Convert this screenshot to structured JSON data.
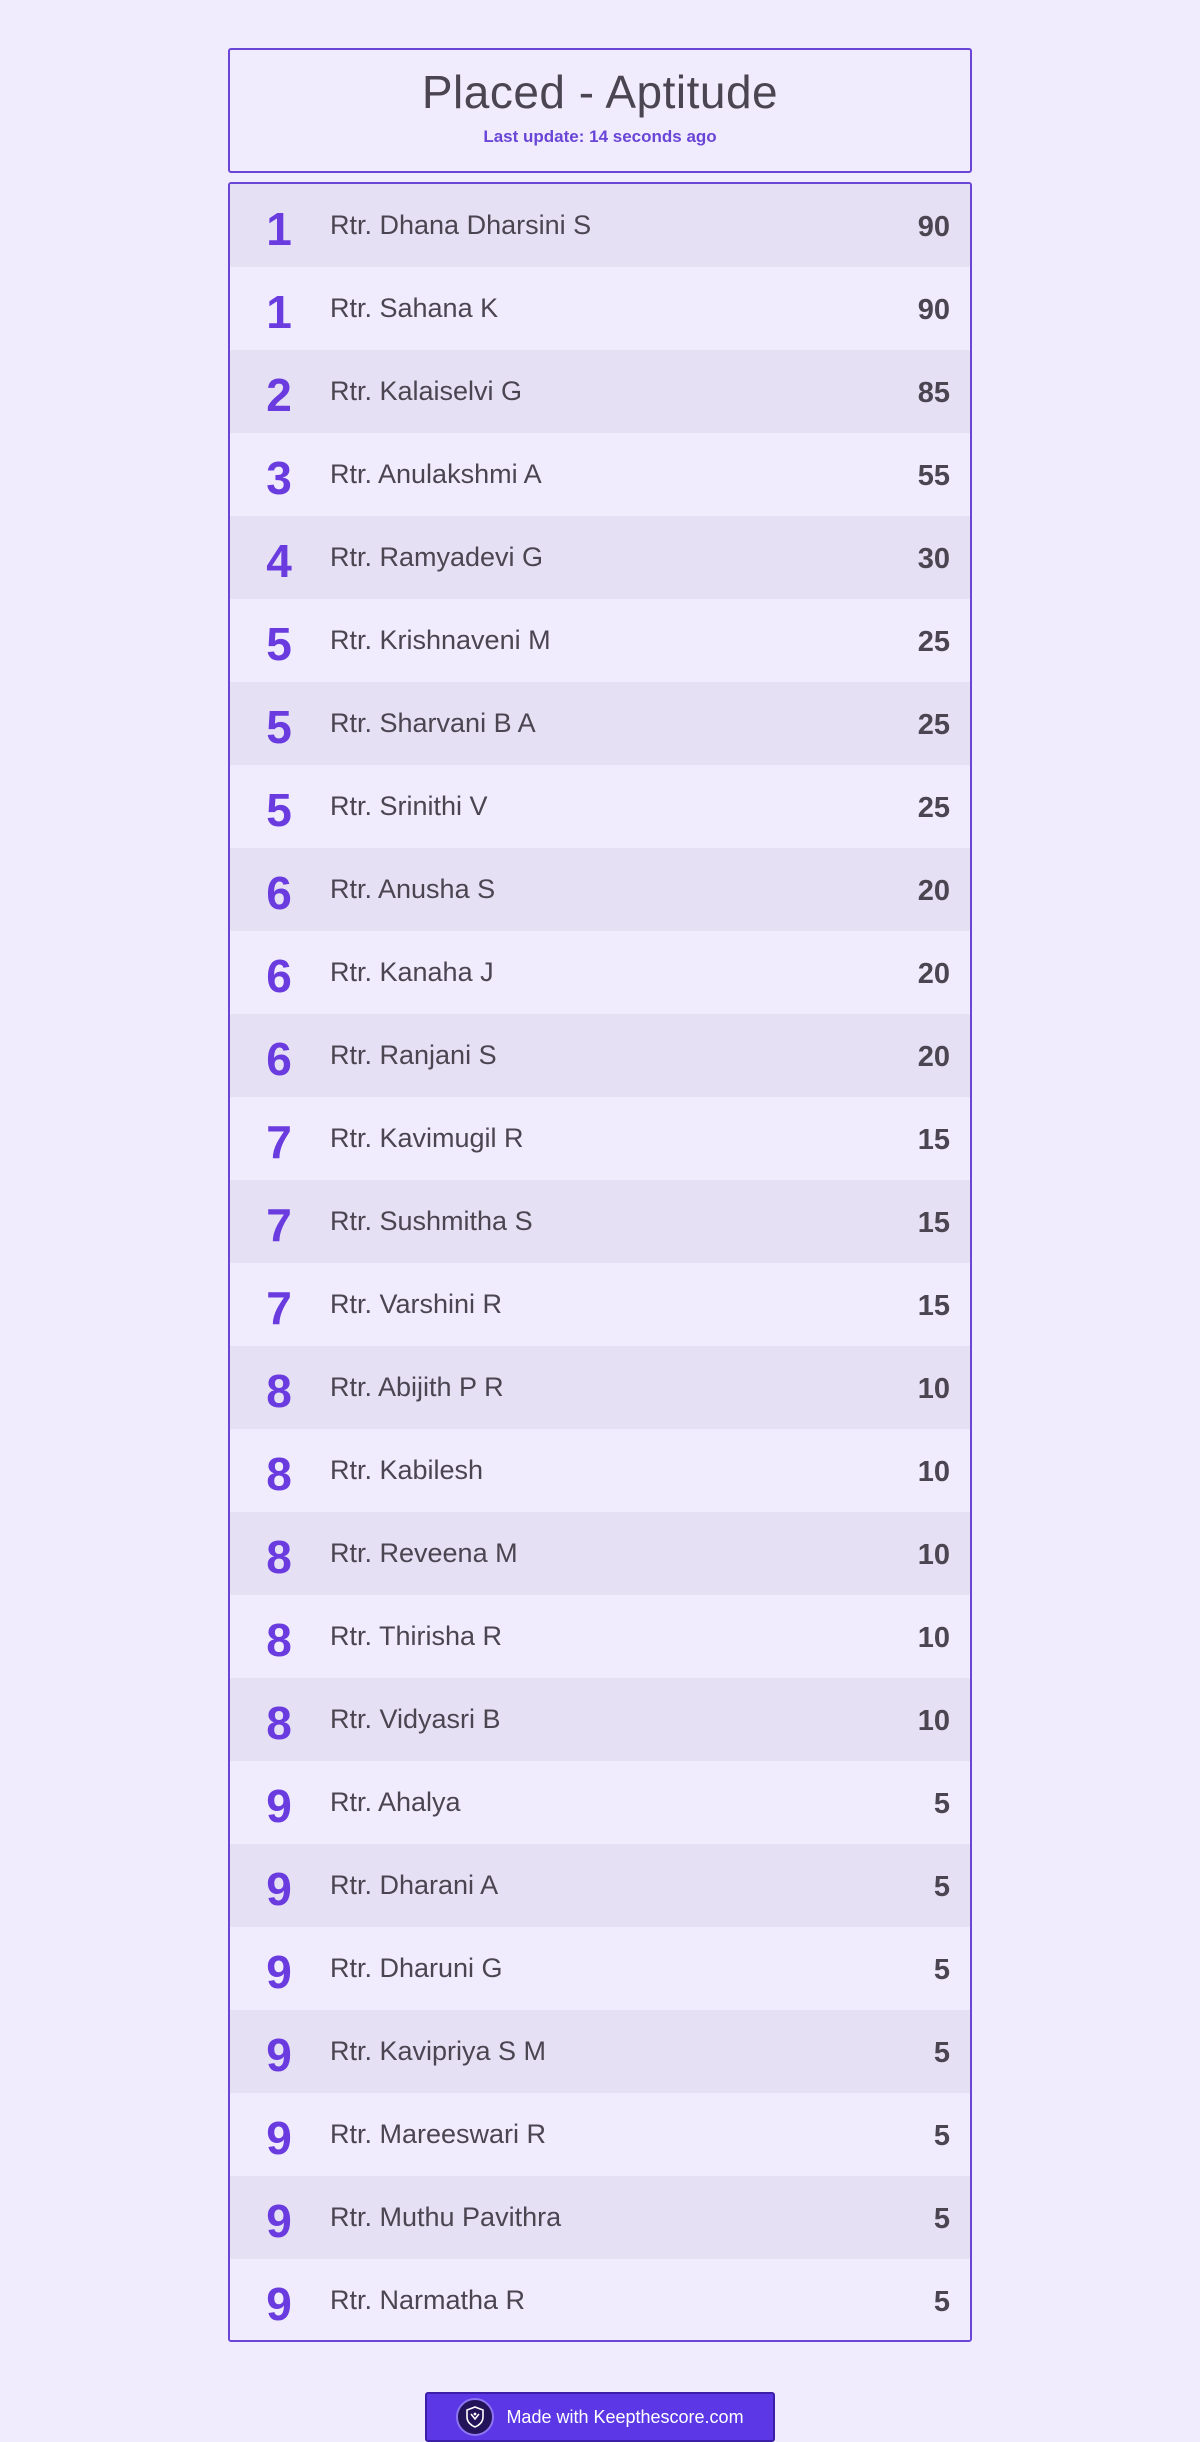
{
  "header": {
    "title": "Placed - Aptitude",
    "last_update": "Last update: 14 seconds ago"
  },
  "leaderboard": {
    "rows": [
      {
        "rank": "1",
        "name": "Rtr. Dhana Dharsini S",
        "score": "90"
      },
      {
        "rank": "1",
        "name": "Rtr. Sahana K",
        "score": "90"
      },
      {
        "rank": "2",
        "name": "Rtr. Kalaiselvi G",
        "score": "85"
      },
      {
        "rank": "3",
        "name": "Rtr. Anulakshmi A",
        "score": "55"
      },
      {
        "rank": "4",
        "name": "Rtr. Ramyadevi G",
        "score": "30"
      },
      {
        "rank": "5",
        "name": "Rtr. Krishnaveni M",
        "score": "25"
      },
      {
        "rank": "5",
        "name": "Rtr. Sharvani B A",
        "score": "25"
      },
      {
        "rank": "5",
        "name": "Rtr. Srinithi V",
        "score": "25"
      },
      {
        "rank": "6",
        "name": "Rtr. Anusha S",
        "score": "20"
      },
      {
        "rank": "6",
        "name": "Rtr. Kanaha J",
        "score": "20"
      },
      {
        "rank": "6",
        "name": "Rtr. Ranjani S",
        "score": "20"
      },
      {
        "rank": "7",
        "name": "Rtr. Kavimugil R",
        "score": "15"
      },
      {
        "rank": "7",
        "name": "Rtr. Sushmitha S",
        "score": "15"
      },
      {
        "rank": "7",
        "name": "Rtr. Varshini R",
        "score": "15"
      },
      {
        "rank": "8",
        "name": "Rtr. Abijith P R",
        "score": "10"
      },
      {
        "rank": "8",
        "name": "Rtr. Kabilesh",
        "score": "10"
      },
      {
        "rank": "8",
        "name": "Rtr. Reveena M",
        "score": "10"
      },
      {
        "rank": "8",
        "name": "Rtr. Thirisha R",
        "score": "10"
      },
      {
        "rank": "8",
        "name": "Rtr. Vidyasri B",
        "score": "10"
      },
      {
        "rank": "9",
        "name": "Rtr. Ahalya",
        "score": "5"
      },
      {
        "rank": "9",
        "name": "Rtr. Dharani A",
        "score": "5"
      },
      {
        "rank": "9",
        "name": "Rtr. Dharuni G",
        "score": "5"
      },
      {
        "rank": "9",
        "name": "Rtr. Kavipriya S M",
        "score": "5"
      },
      {
        "rank": "9",
        "name": "Rtr. Mareeswari R",
        "score": "5"
      },
      {
        "rank": "9",
        "name": "Rtr. Muthu Pavithra",
        "score": "5"
      },
      {
        "rank": "9",
        "name": "Rtr. Narmatha R",
        "score": "5"
      }
    ]
  },
  "footer": {
    "badge_text": "Made with Keepthescore.com",
    "logo_icon": "keepthescore-shield-icon"
  },
  "colors": {
    "accent": "#6a3ce0",
    "background": "#f0ecfd",
    "row_alt": "#e5e0f4",
    "text": "#4a4550",
    "badge": "#5b37e6"
  }
}
